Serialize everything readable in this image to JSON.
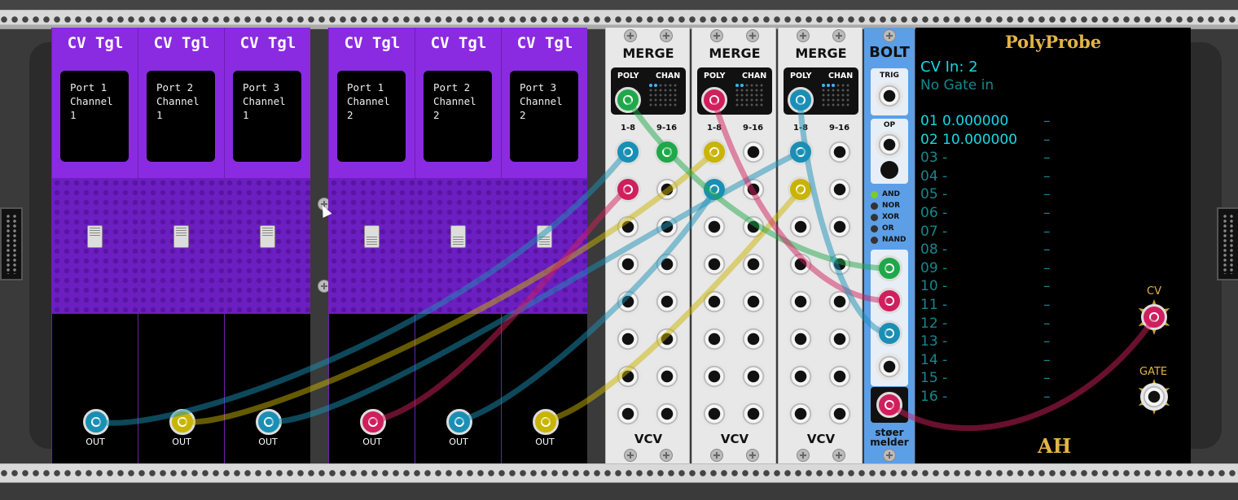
{
  "cvtgl": {
    "title": "CV Tgl",
    "out_label": "OUT",
    "modules": [
      {
        "screen": "Port 1\nChannel\n1",
        "switch": "up",
        "out_color": "#1a8fb5"
      },
      {
        "screen": "Port 2\nChannel\n1",
        "switch": "up",
        "out_color": "#c9b400"
      },
      {
        "screen": "Port 3\nChannel\n1",
        "switch": "up",
        "out_color": "#1a8fb5"
      },
      {
        "screen": "Port 1\nChannel\n2",
        "switch": "down",
        "out_color": "#d01f5c"
      },
      {
        "screen": "Port 2\nChannel\n2",
        "switch": "down",
        "out_color": "#1a8fb5"
      },
      {
        "screen": "Port 3\nChannel\n2",
        "switch": "down",
        "out_color": "#c9b400"
      }
    ]
  },
  "merge": {
    "title": "MERGE",
    "poly_label": "POLY",
    "chan_label": "CHAN",
    "col_a": "1-8",
    "col_b": "9-16",
    "brand": "VCV",
    "modules": [
      {
        "poly_color": "#1fa84a"
      },
      {
        "poly_color": "#d01f5c"
      },
      {
        "poly_color": "#1a8fb5"
      }
    ]
  },
  "bolt": {
    "title": "BOLT",
    "trig_label": "TRIG",
    "op_label": "OP",
    "ops": [
      "AND",
      "NOR",
      "XOR",
      "OR",
      "NAND"
    ],
    "active_op": "AND",
    "brand_line1": "støer",
    "brand_line2": "melder"
  },
  "probe": {
    "title": "PolyProbe",
    "cv_in": "CV In: 2",
    "gate_status": "No Gate in",
    "channels": [
      {
        "label": "01 0.000000",
        "active": true,
        "dash": "–"
      },
      {
        "label": "02 10.000000",
        "active": true,
        "dash": "–"
      },
      {
        "label": "03 -",
        "active": false,
        "dash": "–"
      },
      {
        "label": "04 -",
        "active": false,
        "dash": "–"
      },
      {
        "label": "05 -",
        "active": false,
        "dash": "–"
      },
      {
        "label": "06 -",
        "active": false,
        "dash": "–"
      },
      {
        "label": "07 -",
        "active": false,
        "dash": "–"
      },
      {
        "label": "08 -",
        "active": false,
        "dash": "–"
      },
      {
        "label": "09 -",
        "active": false,
        "dash": "–"
      },
      {
        "label": "10 -",
        "active": false,
        "dash": "–"
      },
      {
        "label": "11 -",
        "active": false,
        "dash": "–"
      },
      {
        "label": "12 -",
        "active": false,
        "dash": "–"
      },
      {
        "label": "13 -",
        "active": false,
        "dash": "–"
      },
      {
        "label": "14 -",
        "active": false,
        "dash": "–"
      },
      {
        "label": "15 -",
        "active": false,
        "dash": "–"
      },
      {
        "label": "16 -",
        "active": false,
        "dash": "–"
      }
    ],
    "cv_label": "CV",
    "gate_label": "GATE",
    "logo": "AH"
  },
  "colors": {
    "green": "#1fa84a",
    "red": "#d01f5c",
    "blue": "#1a8fb5",
    "yellow": "#c9b400",
    "purple": "#8a2be2",
    "bolt_blue": "#5c9fe6"
  }
}
